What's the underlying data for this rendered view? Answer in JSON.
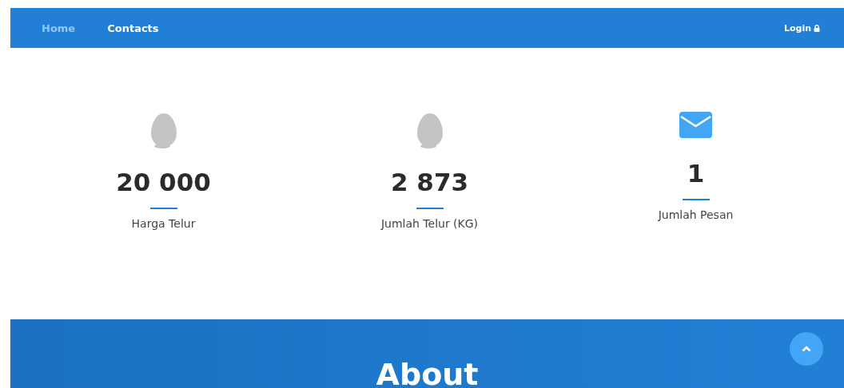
{
  "navbar": {
    "links": [
      {
        "label": "Home",
        "selected": true
      },
      {
        "label": "Contacts",
        "selected": false
      }
    ],
    "login": {
      "label": "Login"
    }
  },
  "stats": [
    {
      "kind": "egg",
      "value": "20 000",
      "label": "Harga Telur"
    },
    {
      "kind": "egg",
      "value": "2 873",
      "label": "Jumlah Telur (KG)"
    },
    {
      "kind": "mail",
      "value": "1",
      "label": "Jumlah Pesan"
    }
  ],
  "about": {
    "title": "About"
  }
}
